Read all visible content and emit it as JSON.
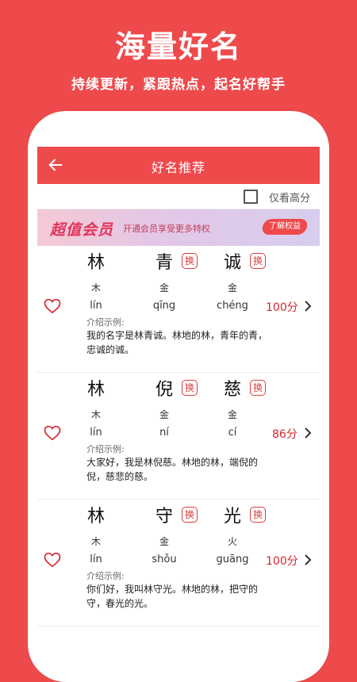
{
  "promo": {
    "title": "海量好名",
    "subtitle": "持续更新，紧跟热点，起名好帮手"
  },
  "colors": {
    "brand": "#ee4a4c",
    "score": "#d7262b"
  },
  "appbar": {
    "title": "好名推荐",
    "back_icon": "arrow-left-icon"
  },
  "filter": {
    "label": "仅看高分",
    "checked": false
  },
  "vip": {
    "title": "超值会员",
    "desc": "开通会员享受更多特权",
    "button": "了解权益"
  },
  "swap_label": "换",
  "intro_label": "介绍示例:",
  "names": [
    {
      "chars": [
        {
          "char": "林",
          "element": "木",
          "pinyin": "lín"
        },
        {
          "char": "青",
          "element": "金",
          "pinyin": "qīng"
        },
        {
          "char": "诚",
          "element": "金",
          "pinyin": "chéng"
        }
      ],
      "score": "100分",
      "intro": "我的名字是林青诚。林地的林，青年的青，忠诚的诚。"
    },
    {
      "chars": [
        {
          "char": "林",
          "element": "木",
          "pinyin": "lín"
        },
        {
          "char": "倪",
          "element": "金",
          "pinyin": "ní"
        },
        {
          "char": "慈",
          "element": "金",
          "pinyin": "cí"
        }
      ],
      "score": "86分",
      "intro": "大家好，我是林倪慈。林地的林，端倪的倪，慈悲的慈。"
    },
    {
      "chars": [
        {
          "char": "林",
          "element": "木",
          "pinyin": "lín"
        },
        {
          "char": "守",
          "element": "金",
          "pinyin": "shǒu"
        },
        {
          "char": "光",
          "element": "火",
          "pinyin": "guāng"
        }
      ],
      "score": "100分",
      "intro": "你们好，我叫林守光。林地的林，把守的守，春光的光。"
    }
  ]
}
